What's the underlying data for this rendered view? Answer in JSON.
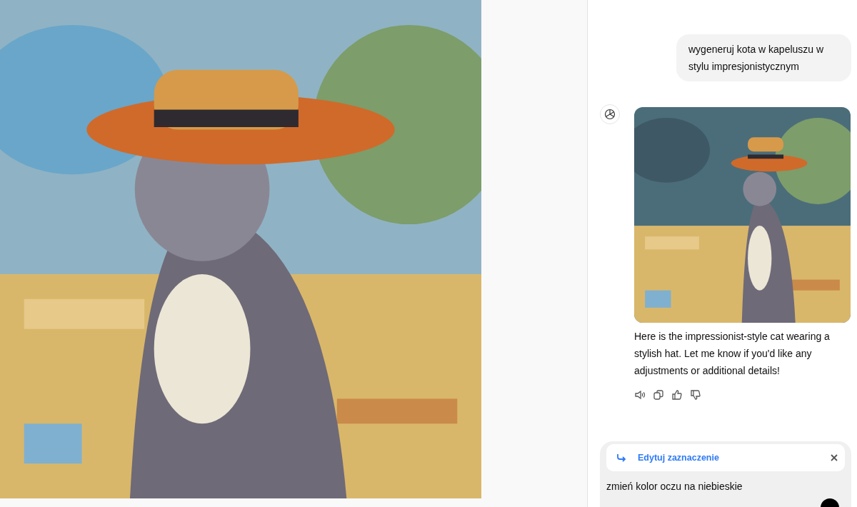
{
  "chat": {
    "messages": [
      {
        "kind": "user",
        "text": "wygeneruj kota w kapeluszu w stylu impresjonistycznym"
      },
      {
        "kind": "assistant",
        "text": "Here is the impressionist-style cat wearing a stylish hat. Let me know if you'd like any adjustments or additional details!"
      }
    ]
  },
  "composer": {
    "selection_label": "Edytuj zaznaczenie",
    "value": "zmień kolor oczu na niebieskie"
  }
}
